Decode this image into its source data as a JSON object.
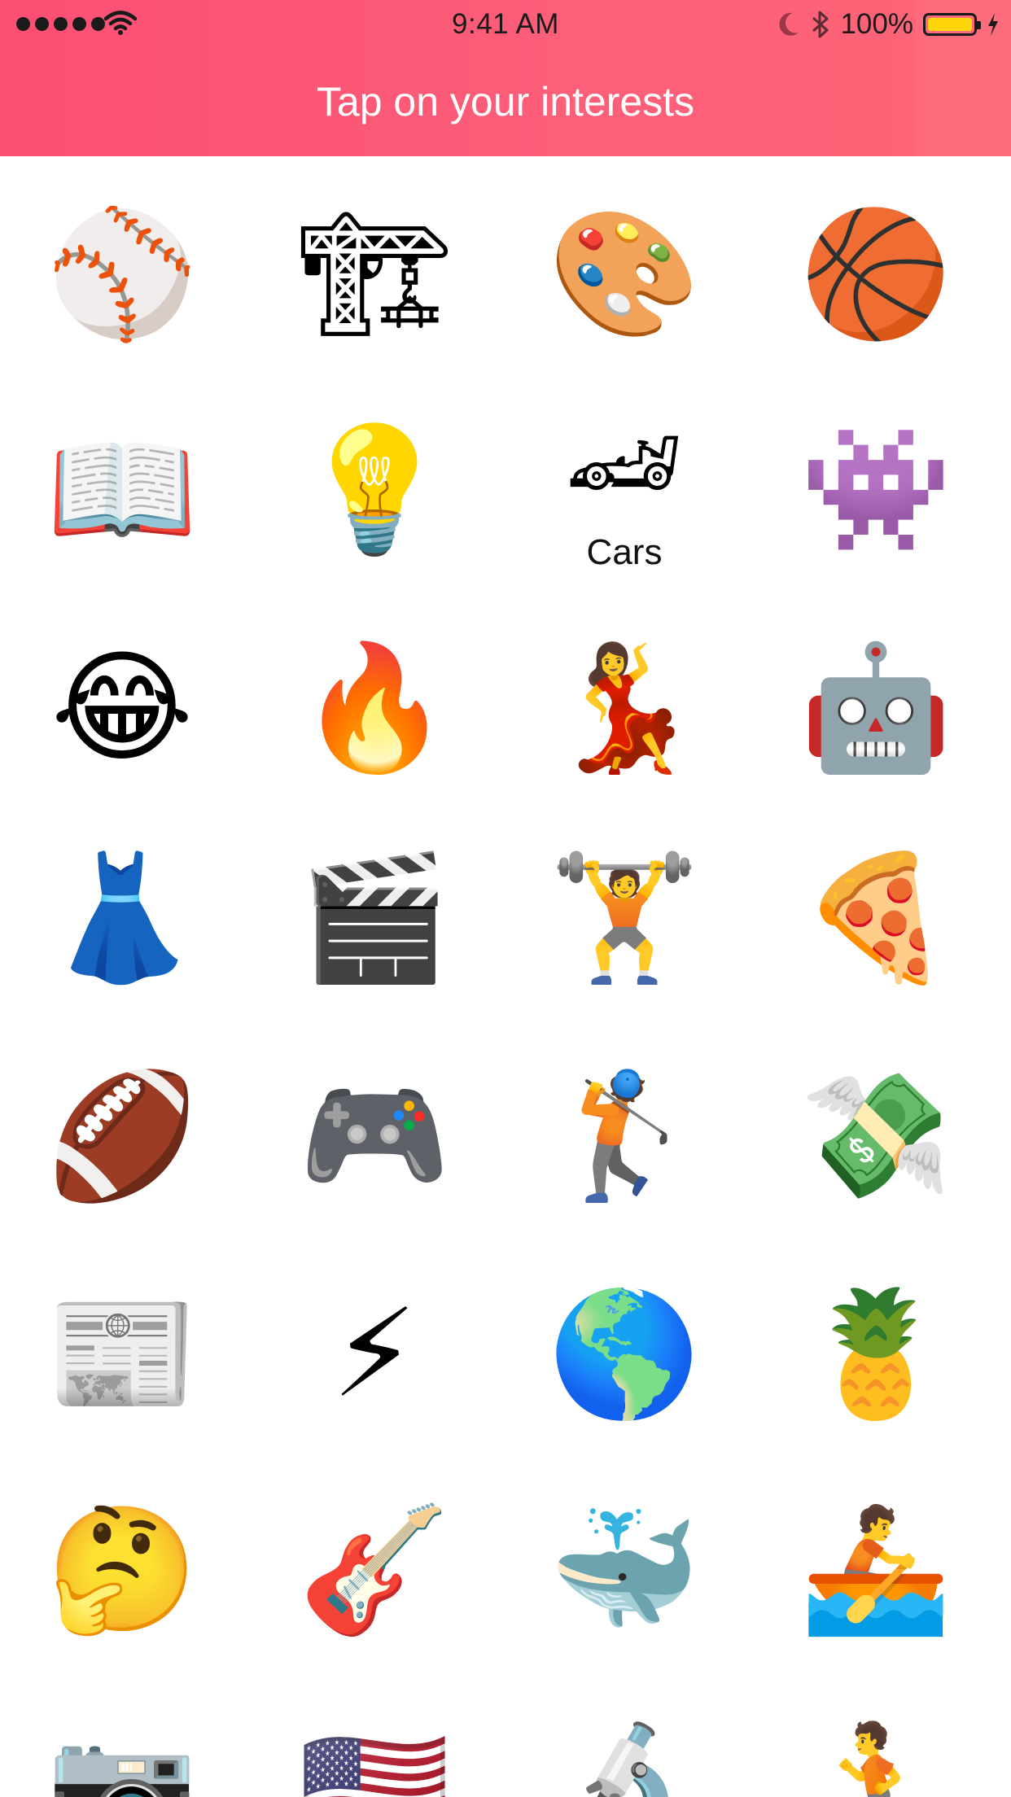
{
  "status_bar": {
    "time": "9:41 AM",
    "battery": "100%",
    "icons": [
      "signal-dots-icon",
      "wifi-icon",
      "moon-icon",
      "bluetooth-icon",
      "battery-icon",
      "charging-bolt-icon"
    ]
  },
  "header": {
    "title": "Tap on your interests",
    "color": "#fb5575"
  },
  "interests": [
    {
      "emoji": "⚾",
      "icon": "baseball-icon",
      "label": ""
    },
    {
      "emoji": "🏗",
      "icon": "construction-crane-icon",
      "label": ""
    },
    {
      "emoji": "🎨",
      "icon": "art-palette-icon",
      "label": ""
    },
    {
      "emoji": "🏀",
      "icon": "basketball-icon",
      "label": ""
    },
    {
      "emoji": "📖",
      "icon": "open-book-icon",
      "label": ""
    },
    {
      "emoji": "💡",
      "icon": "lightbulb-icon",
      "label": ""
    },
    {
      "emoji": "🏎",
      "icon": "race-car-icon",
      "label": "Cars"
    },
    {
      "emoji": "👾",
      "icon": "space-invader-icon",
      "label": ""
    },
    {
      "emoji": "😂",
      "icon": "tears-of-joy-icon",
      "label": ""
    },
    {
      "emoji": "🔥",
      "icon": "fire-icon",
      "label": ""
    },
    {
      "emoji": "💃",
      "icon": "dancer-icon",
      "label": ""
    },
    {
      "emoji": "🤖",
      "icon": "robot-icon",
      "label": ""
    },
    {
      "emoji": "👗",
      "icon": "dress-icon",
      "label": ""
    },
    {
      "emoji": "🎬",
      "icon": "clapperboard-icon",
      "label": ""
    },
    {
      "emoji": "🏋",
      "icon": "weightlifter-icon",
      "label": ""
    },
    {
      "emoji": "🍕",
      "icon": "pizza-icon",
      "label": ""
    },
    {
      "emoji": "🏈",
      "icon": "football-icon",
      "label": ""
    },
    {
      "emoji": "🎮",
      "icon": "game-controller-icon",
      "label": ""
    },
    {
      "emoji": "🏌",
      "icon": "golfer-icon",
      "label": ""
    },
    {
      "emoji": "💸",
      "icon": "money-wings-icon",
      "label": ""
    },
    {
      "emoji": "📰",
      "icon": "newspaper-icon",
      "label": ""
    },
    {
      "emoji": "⚡",
      "icon": "lightning-icon",
      "label": ""
    },
    {
      "emoji": "🌎",
      "icon": "globe-americas-icon",
      "label": ""
    },
    {
      "emoji": "🍍",
      "icon": "pineapple-icon",
      "label": ""
    },
    {
      "emoji": "🤔",
      "icon": "thinking-face-icon",
      "label": ""
    },
    {
      "emoji": "🎸",
      "icon": "guitar-icon",
      "label": ""
    },
    {
      "emoji": "🐳",
      "icon": "whale-icon",
      "label": ""
    },
    {
      "emoji": "🚣",
      "icon": "rowboat-icon",
      "label": ""
    },
    {
      "emoji": "📷",
      "icon": "camera-icon",
      "label": ""
    },
    {
      "emoji": "🇺🇸",
      "icon": "us-flag-icon",
      "label": ""
    },
    {
      "emoji": "🔬",
      "icon": "microscope-icon",
      "label": ""
    },
    {
      "emoji": "🏃",
      "icon": "runner-icon",
      "label": ""
    }
  ]
}
